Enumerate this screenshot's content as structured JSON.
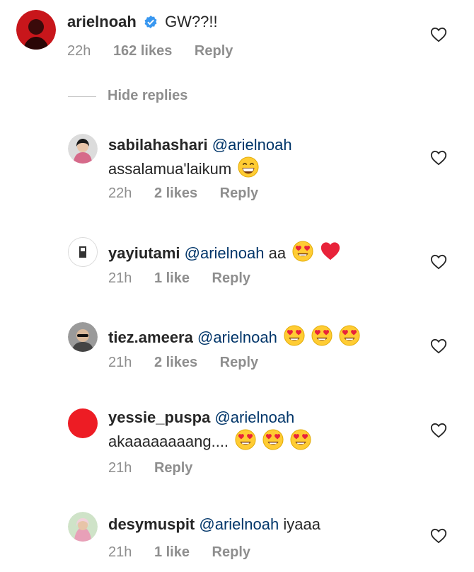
{
  "main_comment": {
    "username": "arielnoah",
    "text": "GW??!!",
    "time": "22h",
    "likes": "162 likes",
    "reply_label": "Reply"
  },
  "hide_replies_label": "Hide replies",
  "replies": [
    {
      "username": "sabilahashari",
      "mention": "@arielnoah",
      "text": "",
      "line2": "assalamua'laikum",
      "time": "22h",
      "likes": "2 likes",
      "reply_label": "Reply"
    },
    {
      "username": "yayiutami",
      "mention": "@arielnoah",
      "text": "aa",
      "time": "21h",
      "likes": "1 like",
      "reply_label": "Reply"
    },
    {
      "username": "tiez.ameera",
      "mention": "@arielnoah",
      "text": "",
      "time": "21h",
      "likes": "2 likes",
      "reply_label": "Reply"
    },
    {
      "username": "yessie_puspa",
      "mention": "@arielnoah",
      "text": "",
      "line2": "akaaaaaaaang....",
      "time": "21h",
      "reply_label": "Reply"
    },
    {
      "username": "desymuspit",
      "mention": "@arielnoah",
      "text": "iyaaa",
      "time": "21h",
      "likes": "1 like",
      "reply_label": "Reply"
    }
  ],
  "colors": {
    "mention": "#003569",
    "meta": "#8e8e8e",
    "verified": "#3897f0",
    "avatar_red": "#ed1c24"
  }
}
